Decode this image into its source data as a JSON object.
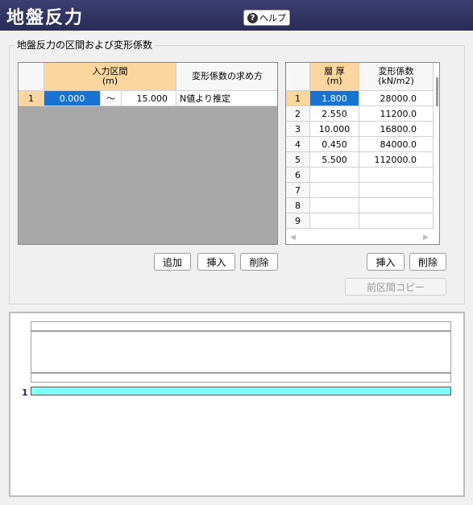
{
  "window": {
    "title": "地盤反力",
    "help_label": "ヘルプ"
  },
  "group": {
    "label": "地盤反力の区間および変形係数"
  },
  "interval_table": {
    "headers": {
      "input_range": "入力区間",
      "input_unit": "(m)",
      "method": "変形係数の求め方"
    },
    "rows": [
      {
        "no": "1",
        "from": "0.000",
        "sep": "〜",
        "to": "15.000",
        "method": "N値より推定"
      }
    ]
  },
  "layer_table": {
    "headers": {
      "thickness": "層 厚",
      "thickness_unit": "(m)",
      "modulus": "変形係数",
      "modulus_unit": "(kN/m2)"
    },
    "rows": [
      {
        "no": "1",
        "thickness": "1.800",
        "modulus": "28000.0"
      },
      {
        "no": "2",
        "thickness": "2.550",
        "modulus": "11200.0"
      },
      {
        "no": "3",
        "thickness": "10.000",
        "modulus": "16800.0"
      },
      {
        "no": "4",
        "thickness": "0.450",
        "modulus": "84000.0"
      },
      {
        "no": "5",
        "thickness": "5.500",
        "modulus": "112000.0"
      },
      {
        "no": "6",
        "thickness": "",
        "modulus": ""
      },
      {
        "no": "7",
        "thickness": "",
        "modulus": ""
      },
      {
        "no": "8",
        "thickness": "",
        "modulus": ""
      },
      {
        "no": "9",
        "thickness": "",
        "modulus": ""
      }
    ]
  },
  "buttons": {
    "add": "追加",
    "insert": "挿入",
    "delete": "削除",
    "insert2": "挿入",
    "delete2": "削除",
    "copy_prev": "前区間コピー"
  },
  "preview": {
    "row_label": "1"
  },
  "colors": {
    "title_bg": "#2f3160",
    "header_selected": "#fbd79f",
    "selection": "#1874d0",
    "bar": "#80ffff"
  },
  "icons": {
    "help": "question-circle-icon",
    "scroll_left": "arrow-left-icon",
    "scroll_right": "arrow-right-icon"
  }
}
